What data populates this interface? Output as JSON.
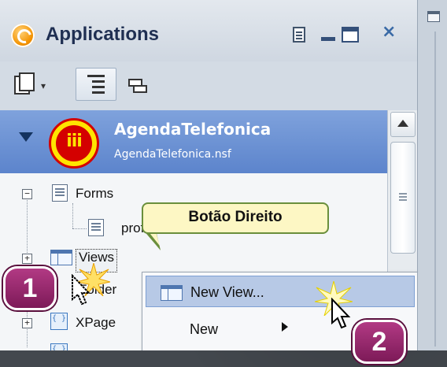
{
  "panel": {
    "title": "Applications",
    "close_glyph": "×"
  },
  "toolbar": {
    "new_icon": "new-document-icon",
    "dropdown_caret": "▾",
    "view_toggle_icon": "list-view-icon",
    "stack_icon": "stacked-view-icon"
  },
  "database": {
    "name": "AgendaTelefonica",
    "file": "AgendaTelefonica.nsf",
    "icon_text": "iii"
  },
  "tree": {
    "forms_label": "Forms",
    "profile_label": "profile",
    "views_label": "Views",
    "folders_label": "Folder",
    "xpages_label": "XPage",
    "collapse_glyph": "−",
    "expand_glyph": "+"
  },
  "callout": {
    "text": "Botão Direito"
  },
  "context_menu": {
    "items": [
      {
        "label": "New View..."
      },
      {
        "label": "New"
      }
    ]
  },
  "badges": {
    "step1": "1",
    "step2": "2"
  },
  "colors": {
    "badge": "#9b2a6e",
    "selection": "#6b90d2",
    "menu_highlight": "#b7c9e6",
    "callout_fill": "#fdf7c4"
  }
}
